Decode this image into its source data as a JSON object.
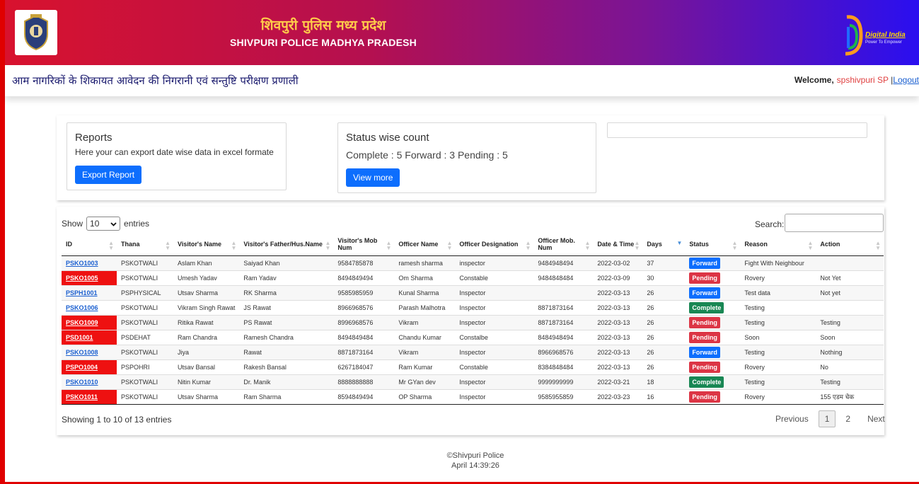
{
  "header": {
    "title_hindi": "शिवपुरी पुलिस मध्य प्रदेश",
    "title_english": "SHIVPURI POLICE MADHYA PRADESH",
    "right_logo_text": "Digital India",
    "right_logo_tagline": "Power To Empower"
  },
  "subbar": {
    "system_title": "आम नागरिकों के शिकायत आवेदन की निगरानी एवं सन्तुष्टि परीक्षण प्रणाली",
    "welcome_label": "Welcome,",
    "user_name": "spshivpuri SP",
    "separator": "|",
    "logout_label": "Logout"
  },
  "reports_card": {
    "title": "Reports",
    "description": "Here your can export date wise data in excel formate",
    "button_label": "Export Report"
  },
  "status_card": {
    "title": "Status wise count",
    "counts_text": "Complete : 5 Forward : 3 Pending : 5",
    "button_label": "View more"
  },
  "table_controls": {
    "show_label": "Show",
    "entries_value": "10",
    "entries_label": "entries",
    "search_label": "Search:"
  },
  "table": {
    "columns": [
      "ID",
      "Thana",
      "Visitor's Name",
      "Visitor's Father/Hus.Name",
      "Visitor's Mob Num",
      "Officer Name",
      "Officer Designation",
      "Officer Mob. Num",
      "Date & Time",
      "Days",
      "Status",
      "Reason",
      "Action"
    ],
    "rows": [
      {
        "id": "PSKO1003",
        "thana": "PSKOTWALI",
        "visitor": "Aslam Khan",
        "father": "Saiyad Khan",
        "mob": "9584785878",
        "officer": "ramesh sharma",
        "designation": "inspector",
        "officer_mob": "9484948494",
        "date": "2022-03-02",
        "days": "37",
        "status": "Forward",
        "reason": "Fight With Neighbour",
        "action": ""
      },
      {
        "id": "PSKO1005",
        "thana": "PSKOTWALI",
        "visitor": "Umesh Yadav",
        "father": "Ram Yadav",
        "mob": "8494849494",
        "officer": "Om Sharma",
        "designation": "Constable",
        "officer_mob": "9484848484",
        "date": "2022-03-09",
        "days": "30",
        "status": "Pending",
        "reason": "Rovery",
        "action": "Not Yet"
      },
      {
        "id": "PSPH1001",
        "thana": "PSPHYSICAL",
        "visitor": "Utsav Sharma",
        "father": "RK Sharma",
        "mob": "9585985959",
        "officer": "Kunal Sharma",
        "designation": "Inspector",
        "officer_mob": "",
        "date": "2022-03-13",
        "days": "26",
        "status": "Forward",
        "reason": "Test data",
        "action": "Not yet"
      },
      {
        "id": "PSKO1006",
        "thana": "PSKOTWALI",
        "visitor": "Vikram Singh Rawat",
        "father": "JS Rawat",
        "mob": "8966968576",
        "officer": "Parash Malhotra",
        "designation": "Inspector",
        "officer_mob": "8871873164",
        "date": "2022-03-13",
        "days": "26",
        "status": "Complete",
        "reason": "Testing",
        "action": ""
      },
      {
        "id": "PSKO1009",
        "thana": "PSKOTWALI",
        "visitor": "Ritika Rawat",
        "father": "PS Rawat",
        "mob": "8996968576",
        "officer": "Vikram",
        "designation": "Inspector",
        "officer_mob": "8871873164",
        "date": "2022-03-13",
        "days": "26",
        "status": "Pending",
        "reason": "Testing",
        "action": "Testing"
      },
      {
        "id": "PSD1001",
        "thana": "PSDEHAT",
        "visitor": "Ram Chandra",
        "father": "Ramesh Chandra",
        "mob": "8494849484",
        "officer": "Chandu Kumar",
        "designation": "Constalbe",
        "officer_mob": "8484948494",
        "date": "2022-03-13",
        "days": "26",
        "status": "Pending",
        "reason": "Soon",
        "action": "Soon"
      },
      {
        "id": "PSKO1008",
        "thana": "PSKOTWALI",
        "visitor": "Jiya",
        "father": "Rawat",
        "mob": "8871873164",
        "officer": "Vikram",
        "designation": "Inspector",
        "officer_mob": "8966968576",
        "date": "2022-03-13",
        "days": "26",
        "status": "Forward",
        "reason": "Testing",
        "action": "Nothing"
      },
      {
        "id": "PSPO1004",
        "thana": "PSPOHRI",
        "visitor": "Utsav Bansal",
        "father": "Rakesh Bansal",
        "mob": "6267184047",
        "officer": "Ram Kumar",
        "designation": "Constable",
        "officer_mob": "8384848484",
        "date": "2022-03-13",
        "days": "26",
        "status": "Pending",
        "reason": "Rovery",
        "action": "No"
      },
      {
        "id": "PSKO1010",
        "thana": "PSKOTWALI",
        "visitor": "Nitin Kumar",
        "father": "Dr. Manik",
        "mob": "8888888888",
        "officer": "Mr GYan dev",
        "designation": "Inspector",
        "officer_mob": "9999999999",
        "date": "2022-03-21",
        "days": "18",
        "status": "Complete",
        "reason": "Testing",
        "action": "Testing"
      },
      {
        "id": "PSKO1011",
        "thana": "PSKOTWALI",
        "visitor": "Utsav Sharma",
        "father": "Ram Sharma",
        "mob": "8594849494",
        "officer": "OP Sharma",
        "designation": "Inspector",
        "officer_mob": "9585955859",
        "date": "2022-03-23",
        "days": "16",
        "status": "Pending",
        "reason": "Rovery",
        "action": "155 एडम चेक"
      }
    ]
  },
  "pagination": {
    "info": "Showing 1 to 10 of 13 entries",
    "previous": "Previous",
    "pages": [
      "1",
      "2"
    ],
    "next": "Next"
  },
  "footer": {
    "copyright": "©Shivpuri Police",
    "time": "April 14:39:26"
  },
  "colors": {
    "forward": "#0d6efd",
    "pending": "#dc3545",
    "complete": "#198754",
    "row_id_highlight": "#ee1111"
  },
  "icons": [
    "mp-police-emblem-icon",
    "digital-india-logo-icon",
    "chevron-down-icon",
    "sort-arrows-icon",
    "filter-icon"
  ]
}
